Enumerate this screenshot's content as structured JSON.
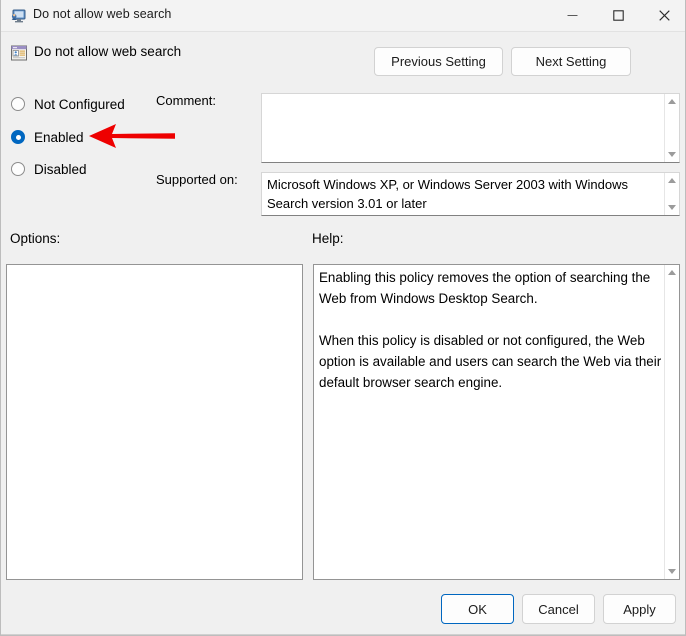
{
  "window": {
    "title": "Do not allow web search",
    "icon": "policy-monitor-icon",
    "controls": {
      "minimize": "minimize-icon",
      "maximize": "maximize-icon",
      "close": "close-icon"
    }
  },
  "header": {
    "icon": "group-policy-setting-icon",
    "title": "Do not allow web search",
    "previous_setting": "Previous Setting",
    "next_setting": "Next Setting"
  },
  "state": {
    "options": [
      {
        "id": "not-configured",
        "label": "Not Configured",
        "selected": false
      },
      {
        "id": "enabled",
        "label": "Enabled",
        "selected": true
      },
      {
        "id": "disabled",
        "label": "Disabled",
        "selected": false
      }
    ],
    "selected": "Enabled"
  },
  "comment": {
    "label": "Comment:",
    "value": "",
    "placeholder": ""
  },
  "supported": {
    "label": "Supported on:",
    "value": "Microsoft Windows XP, or Windows Server 2003 with Windows Search version 3.01 or later"
  },
  "options_panel": {
    "label": "Options:",
    "content": ""
  },
  "help_panel": {
    "label": "Help:",
    "paragraphs": [
      "Enabling this policy removes the option of searching the Web from Windows Desktop Search.",
      "When this policy is disabled or not configured, the Web option is available and users can search the Web via their default browser search engine."
    ]
  },
  "footer": {
    "ok": "OK",
    "cancel": "Cancel",
    "apply": "Apply"
  },
  "annotation": {
    "type": "arrow",
    "direction": "left",
    "color": "#ee0000",
    "points_at": "Enabled"
  },
  "colors": {
    "accent": "#0067c0",
    "dialog_background": "#f0f0f0",
    "titlebar_background": "#f3f3f3",
    "field_background": "#ffffff",
    "text": "#000000",
    "annotation_red": "#ee0000"
  }
}
